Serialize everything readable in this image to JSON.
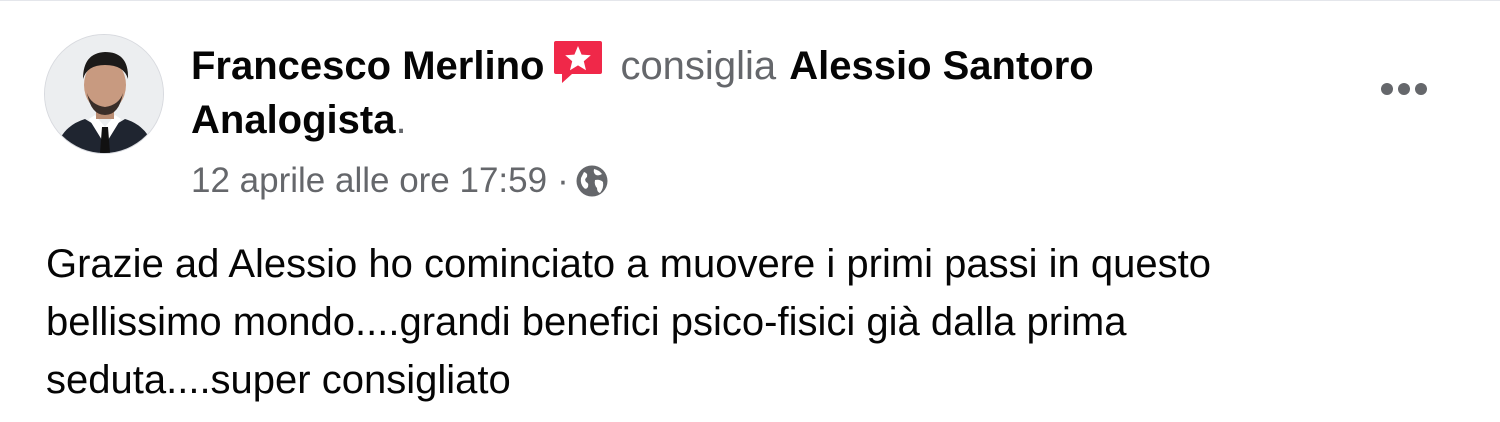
{
  "post": {
    "author": "Francesco Merlino",
    "verb": "consiglia",
    "page_name": "Alessio Santoro Analogista",
    "end_punct": ".",
    "timestamp": "12 aprile alle ore 17:59",
    "separator": "·",
    "audience_icon": "globe-icon",
    "recommend_icon": "recommend-star-icon",
    "more_icon": "more-options-icon",
    "body": "Grazie ad Alessio ho cominciato a muovere i primi passi in questo\nbellissimo mondo....grandi benefici psico-fisici già dalla prima\nseduta....super consigliato"
  },
  "colors": {
    "recommend_red": "#f02849",
    "secondary_text": "#65676b",
    "primary_text": "#050505"
  }
}
